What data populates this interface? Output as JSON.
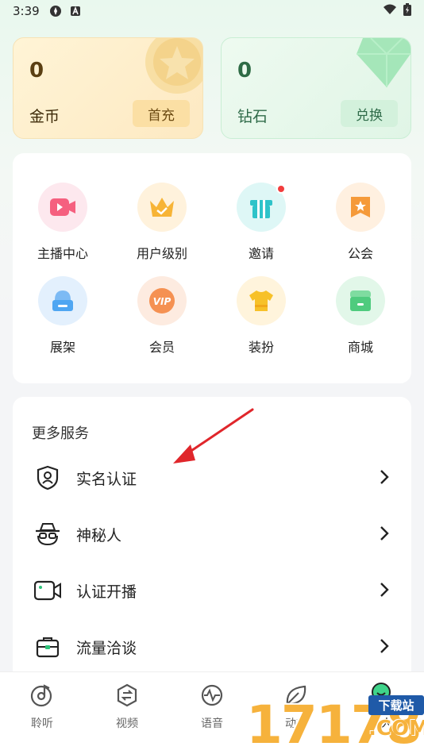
{
  "status_bar": {
    "time": "3:39"
  },
  "wallet": {
    "coins": {
      "amount": "0",
      "label": "金币",
      "action": "首充"
    },
    "diamonds": {
      "amount": "0",
      "label": "钻石",
      "action": "兑换"
    }
  },
  "features": [
    {
      "label": "主播中心",
      "icon": "video-play-icon",
      "color": "#f5607f"
    },
    {
      "label": "用户级别",
      "icon": "crown-icon",
      "color": "#f7b436"
    },
    {
      "label": "邀请",
      "icon": "gift-icon",
      "color": "#2ec3c9",
      "badge": true
    },
    {
      "label": "公会",
      "icon": "bookmark-star-icon",
      "color": "#f59a3a"
    },
    {
      "label": "展架",
      "icon": "shelf-icon",
      "color": "#4fa6f2"
    },
    {
      "label": "会员",
      "icon": "vip-icon",
      "color": "#f59152"
    },
    {
      "label": "装扮",
      "icon": "tshirt-icon",
      "color": "#f7c129"
    },
    {
      "label": "商城",
      "icon": "store-icon",
      "color": "#4fcb7e"
    }
  ],
  "services": {
    "title": "更多服务",
    "items": [
      {
        "label": "实名认证",
        "icon": "shield-user-icon"
      },
      {
        "label": "神秘人",
        "icon": "mystery-person-icon"
      },
      {
        "label": "认证开播",
        "icon": "camera-icon"
      },
      {
        "label": "流量洽谈",
        "icon": "briefcase-icon"
      }
    ]
  },
  "tabs": [
    {
      "label": "聆听",
      "icon": "music-disc-icon"
    },
    {
      "label": "视频",
      "icon": "video-switch-icon"
    },
    {
      "label": "语音",
      "icon": "wave-icon"
    },
    {
      "label": "动态",
      "icon": "leaf-icon"
    },
    {
      "label": "个人",
      "icon": "profile-icon",
      "active": true
    }
  ],
  "watermark": {
    "number": "17178",
    "tag": "下载站",
    "domain": ".COM"
  }
}
